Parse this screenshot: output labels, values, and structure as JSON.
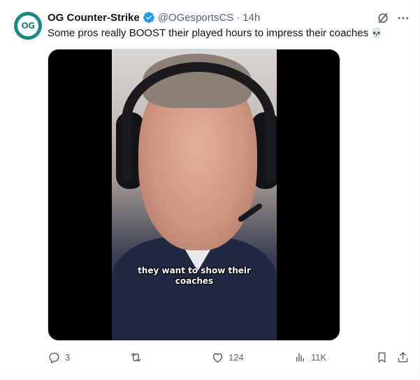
{
  "author": {
    "name": "OG Counter-Strike",
    "handle": "@OGesportsCS",
    "separator": "·",
    "time": "14h",
    "avatar_text": "OG",
    "verified": true
  },
  "tweet": {
    "text": "Some pros really BOOST their played hours to impress their coaches",
    "emoji_icon": "skull-emoji",
    "emoji_char": "💀"
  },
  "media": {
    "caption_line1": "they want to show their",
    "caption_line2": "coaches"
  },
  "actions": {
    "reply_count": "3",
    "repost_count": "",
    "like_count": "124",
    "views_count": "11K"
  },
  "colors": {
    "brand": "#1a8a7e",
    "verified": "#1d9bf0",
    "muted": "#536471",
    "text": "#0f1419"
  }
}
